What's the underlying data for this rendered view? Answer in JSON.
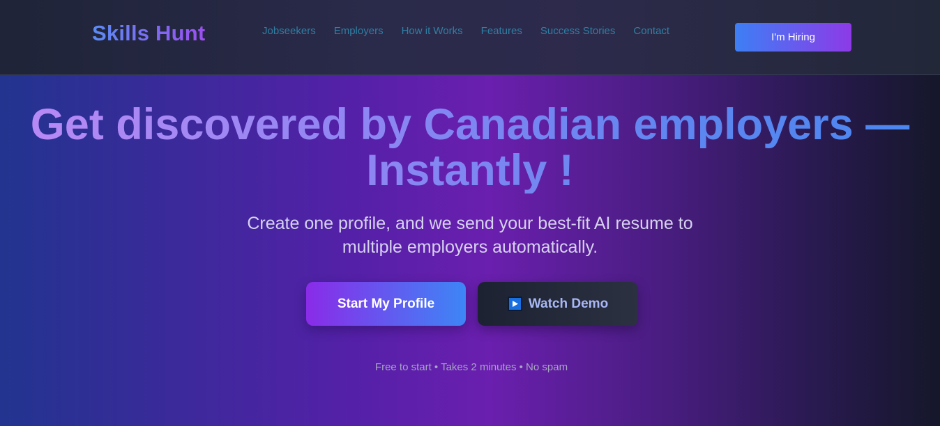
{
  "header": {
    "logo": "Skills Hunt",
    "nav": [
      {
        "label": "Jobseekers"
      },
      {
        "label": "Employers"
      },
      {
        "label": "How it Works"
      },
      {
        "label": "Features"
      },
      {
        "label": "Success Stories"
      },
      {
        "label": "Contact"
      }
    ],
    "hire_button": "I'm Hiring"
  },
  "hero": {
    "title_line1": "Get discovered by Canadian employers —",
    "title_line2": "Instantly !",
    "subtitle_line1": "Create one profile, and we send your best-fit AI resume to",
    "subtitle_line2": "multiple employers automatically.",
    "primary_button": "Start My Profile",
    "demo_button": "Watch Demo",
    "demo_icon": "play-button-icon",
    "note": "Free to start • Takes 2 minutes • No spam"
  },
  "colors": {
    "accent_blue": "#3d7ff5",
    "accent_purple": "#8d3ae6",
    "nav_link": "#2f7fa3"
  }
}
